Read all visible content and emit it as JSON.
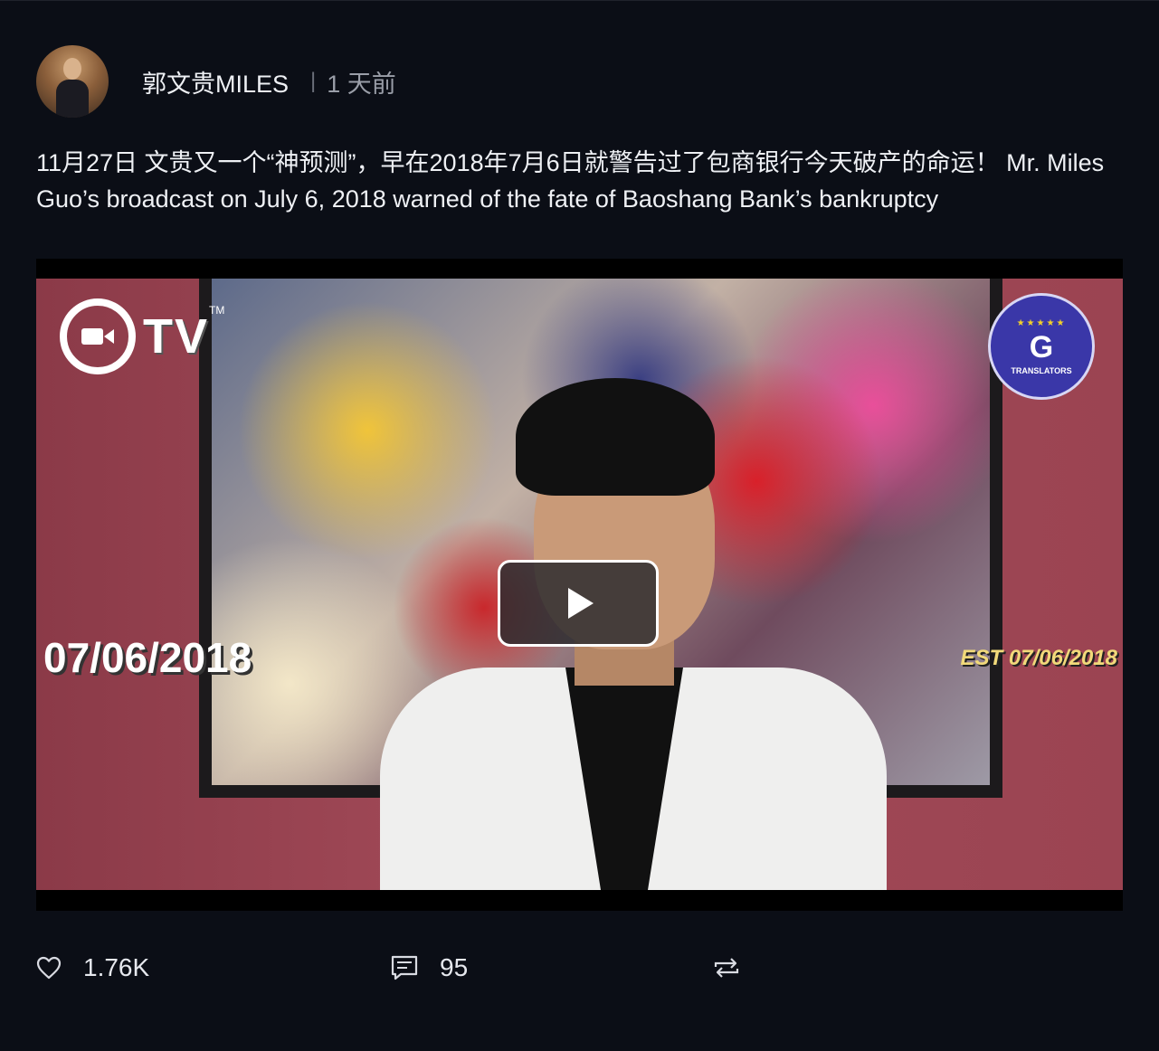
{
  "post": {
    "author": "郭文贵MILES",
    "separator": "|",
    "time_ago": "1 天前",
    "text": "11月27日 文贵又一个“神预测”，早在2018年7月6日就警告过了包商银行今天破产的命运！ Mr. Miles Guo’s broadcast on July 6, 2018 warned of the fate of Baoshang Bank’s bankruptcy"
  },
  "video": {
    "logo_left": "TV",
    "logo_tm": "TM",
    "badge_letter": "G",
    "badge_label": "TRANSLATORS",
    "date_overlay_left": "07/06/2018",
    "date_overlay_right": "EST 07/06/2018",
    "play_icon": "play-icon"
  },
  "actions": {
    "likes": "1.76K",
    "comments": "95",
    "like_icon": "heart-icon",
    "comment_icon": "comment-icon",
    "repost_icon": "repost-icon"
  },
  "colors": {
    "background": "#0b0e16",
    "text": "#eef0f4",
    "muted": "#9a9ea8"
  }
}
